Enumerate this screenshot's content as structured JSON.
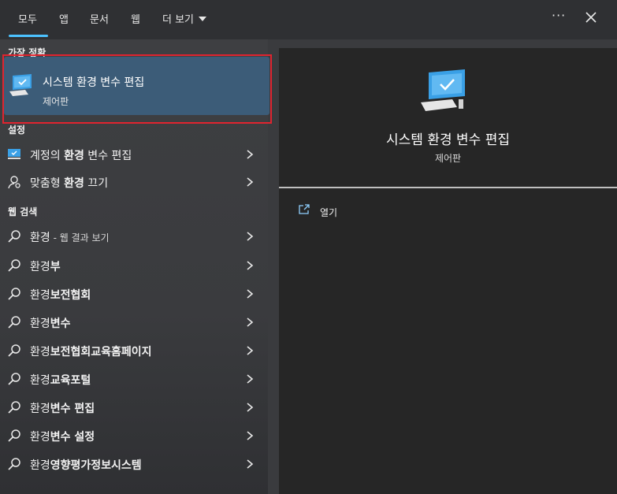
{
  "tabs": [
    {
      "label": "모두",
      "active": true
    },
    {
      "label": "앱"
    },
    {
      "label": "문서"
    },
    {
      "label": "웹"
    },
    {
      "label": "더 보기"
    }
  ],
  "accent_color": "#4cc2ff",
  "best_match": {
    "section_title": "가장 정확",
    "title": "시스템 환경 변수 편집",
    "subtitle": "제어판",
    "icon": "monitor-check-icon"
  },
  "settings": {
    "section_title": "설정",
    "items": [
      {
        "pre": "계정의 ",
        "bold": "환경",
        "post": " 변수 편집",
        "icon": "monitor-icon"
      },
      {
        "pre": "맞춤형 ",
        "bold": "환경",
        "post": " 끄기",
        "icon": "person-settings-icon"
      }
    ]
  },
  "web_search": {
    "section_title": "웹 검색",
    "items": [
      {
        "pre": "",
        "bold": "",
        "post": "환경",
        "suffix": " - 웹 결과 보기"
      },
      {
        "pre": "환경",
        "bold": "부",
        "post": ""
      },
      {
        "pre": "환경",
        "bold": "보전협회",
        "post": ""
      },
      {
        "pre": "환경",
        "bold": "변수",
        "post": ""
      },
      {
        "pre": "환경",
        "bold": "보전협회교육홈페이지",
        "post": ""
      },
      {
        "pre": "환경",
        "bold": "교육포털",
        "post": ""
      },
      {
        "pre": "환경",
        "bold": "변수 편집",
        "post": ""
      },
      {
        "pre": "환경",
        "bold": "변수 설정",
        "post": ""
      },
      {
        "pre": "환경",
        "bold": "영향평가정보시스템",
        "post": ""
      }
    ]
  },
  "preview": {
    "title": "시스템 환경 변수 편집",
    "subtitle": "제어판",
    "actions": [
      {
        "label": "열기",
        "icon": "open-external-icon"
      }
    ]
  }
}
